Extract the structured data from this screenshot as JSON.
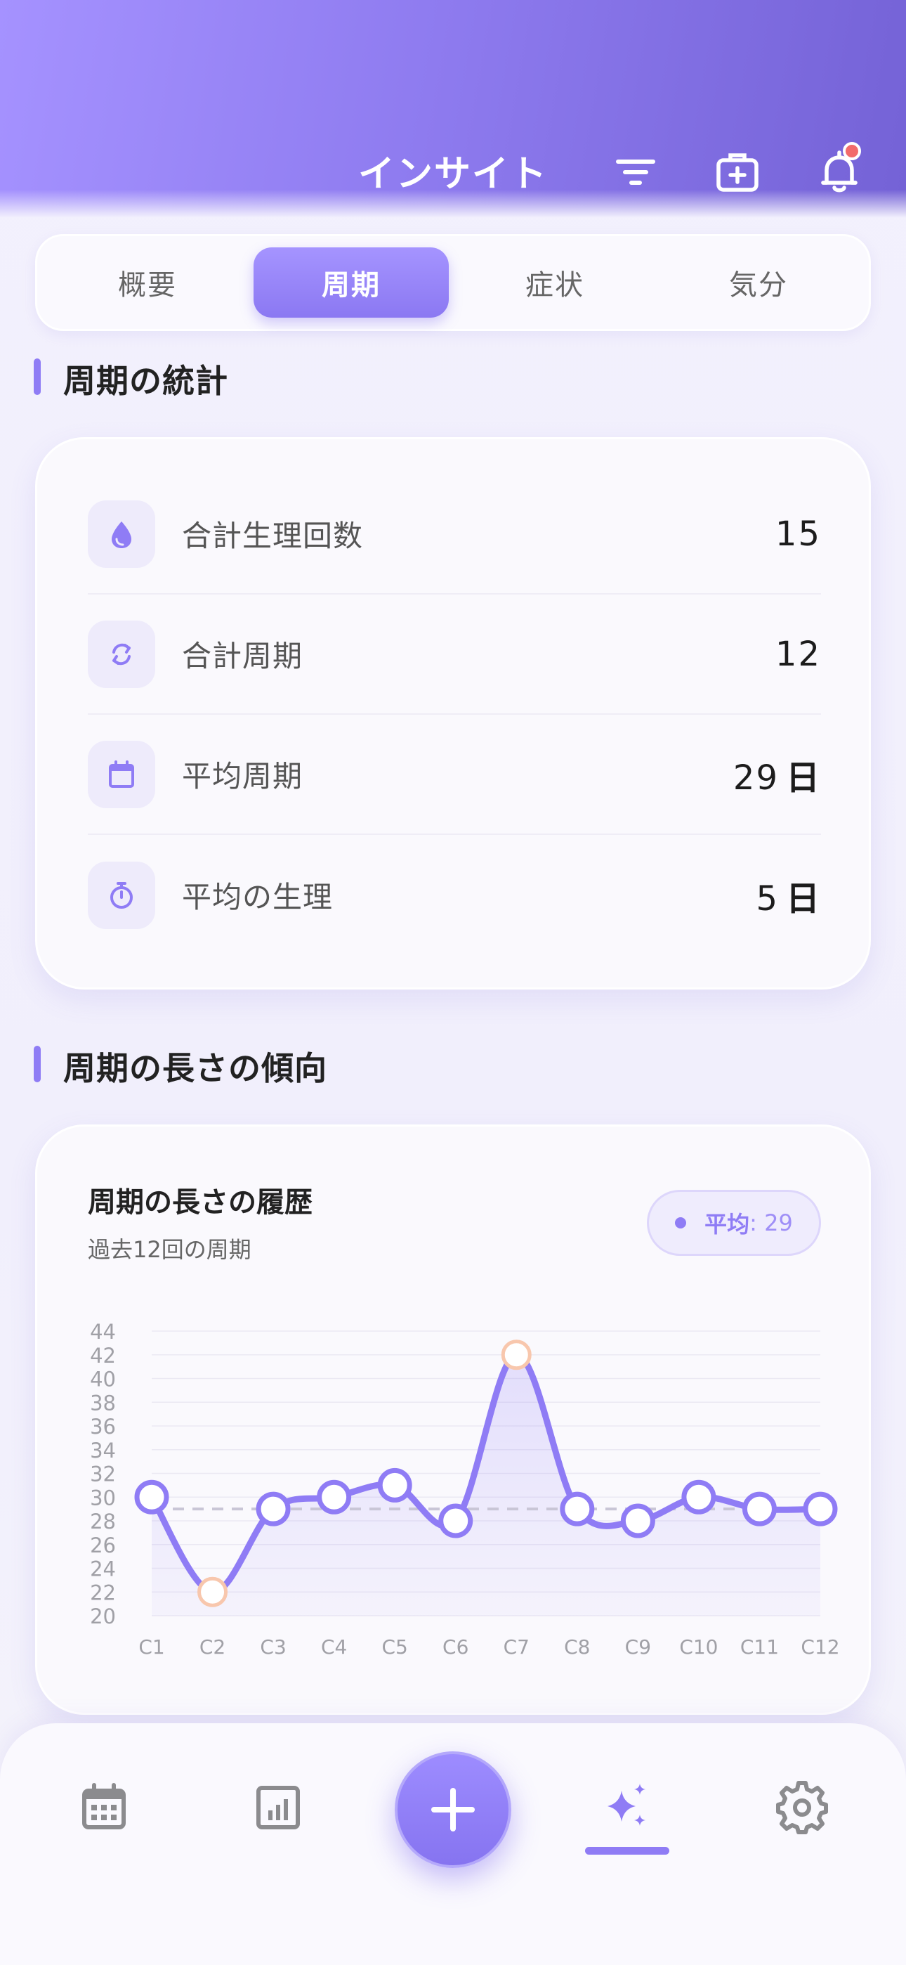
{
  "header": {
    "title": "インサイト",
    "icons": [
      "filter-icon",
      "medical-kit-icon",
      "bell-icon"
    ]
  },
  "tabs": [
    {
      "label": "概要",
      "active": false
    },
    {
      "label": "周期",
      "active": true
    },
    {
      "label": "症状",
      "active": false
    },
    {
      "label": "気分",
      "active": false
    }
  ],
  "stats_section": {
    "title": "周期の統計",
    "rows": [
      {
        "icon": "drop-icon",
        "label": "合計生理回数",
        "value": "15",
        "unit": ""
      },
      {
        "icon": "cycle-icon",
        "label": "合計周期",
        "value": "12",
        "unit": ""
      },
      {
        "icon": "calendar-icon",
        "label": "平均周期",
        "value": "29",
        "unit": "日"
      },
      {
        "icon": "stopwatch-icon",
        "label": "平均の生理",
        "value": "5",
        "unit": "日"
      }
    ]
  },
  "trend_section": {
    "title": "周期の長さの傾向",
    "card_title": "周期の長さの履歴",
    "card_subtitle": "過去12回の周期",
    "avg_label": "平均",
    "avg_value": ": 29"
  },
  "chart_data": {
    "type": "line",
    "categories": [
      "C1",
      "C2",
      "C3",
      "C4",
      "C5",
      "C6",
      "C7",
      "C8",
      "C9",
      "C10",
      "C11",
      "C12"
    ],
    "values": [
      30,
      22,
      29,
      30,
      31,
      28,
      42,
      29,
      28,
      30,
      29,
      29
    ],
    "average": 29,
    "ylim": [
      20,
      44
    ],
    "yticks": [
      20,
      22,
      24,
      26,
      28,
      30,
      32,
      34,
      36,
      38,
      40,
      42,
      44
    ],
    "highlighted": [
      "C2",
      "C7"
    ],
    "colors": {
      "line": "#8f7cf5",
      "highlight": "#f8c7ad",
      "average": "#c9c6d6"
    }
  },
  "bottom_nav": {
    "items": [
      "calendar-icon",
      "chart-icon",
      "add-icon",
      "sparkles-icon",
      "gear-icon"
    ],
    "active": "sparkles-icon"
  },
  "colors": {
    "accent": "#8f7cf5",
    "header_start": "#a592ff",
    "header_end": "#7462d6"
  }
}
